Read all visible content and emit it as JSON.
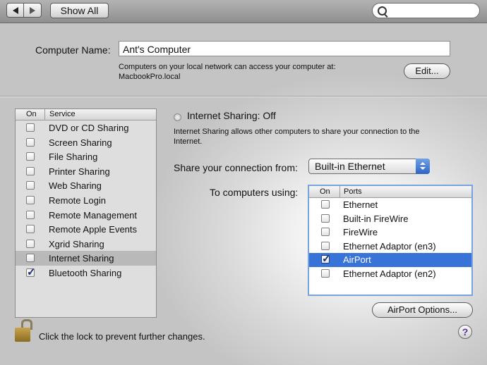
{
  "toolbar": {
    "show_all_label": "Show All",
    "search_placeholder": ""
  },
  "computer": {
    "label": "Computer Name:",
    "value": "Ant's Computer",
    "desc_line1": "Computers on your local network can access your computer at:",
    "desc_line2": "MacbookPro.local",
    "edit_label": "Edit..."
  },
  "services": {
    "header_on": "On",
    "header_service": "Service",
    "items": [
      {
        "label": "DVD or CD Sharing",
        "checked": false,
        "selected": false
      },
      {
        "label": "Screen Sharing",
        "checked": false,
        "selected": false
      },
      {
        "label": "File Sharing",
        "checked": false,
        "selected": false
      },
      {
        "label": "Printer Sharing",
        "checked": false,
        "selected": false
      },
      {
        "label": "Web Sharing",
        "checked": false,
        "selected": false
      },
      {
        "label": "Remote Login",
        "checked": false,
        "selected": false
      },
      {
        "label": "Remote Management",
        "checked": false,
        "selected": false
      },
      {
        "label": "Remote Apple Events",
        "checked": false,
        "selected": false
      },
      {
        "label": "Xgrid Sharing",
        "checked": false,
        "selected": false
      },
      {
        "label": "Internet Sharing",
        "checked": false,
        "selected": true
      },
      {
        "label": "Bluetooth Sharing",
        "checked": true,
        "selected": false
      }
    ]
  },
  "detail": {
    "status": "Internet Sharing: Off",
    "desc_line1": "Internet Sharing allows other computers to share your connection to the",
    "desc_line2": "Internet.",
    "share_from_label": "Share your connection from:",
    "share_from_value": "Built-in Ethernet",
    "to_computers_label": "To computers using:",
    "ports_header_on": "On",
    "ports_header_ports": "Ports",
    "ports": [
      {
        "label": "Ethernet",
        "checked": false,
        "selected": false
      },
      {
        "label": "Built-in FireWire",
        "checked": false,
        "selected": false
      },
      {
        "label": "FireWire",
        "checked": false,
        "selected": false
      },
      {
        "label": "Ethernet Adaptor (en3)",
        "checked": false,
        "selected": false
      },
      {
        "label": "AirPort",
        "checked": true,
        "selected": true
      },
      {
        "label": "Ethernet Adaptor (en2)",
        "checked": false,
        "selected": false
      }
    ],
    "airport_options_label": "AirPort Options..."
  },
  "footer": {
    "lock_text": "Click the lock to prevent further changes.",
    "help_label": "?"
  },
  "colors": {
    "selection": "#3874d8",
    "popup_accent": "#2f63c7"
  }
}
